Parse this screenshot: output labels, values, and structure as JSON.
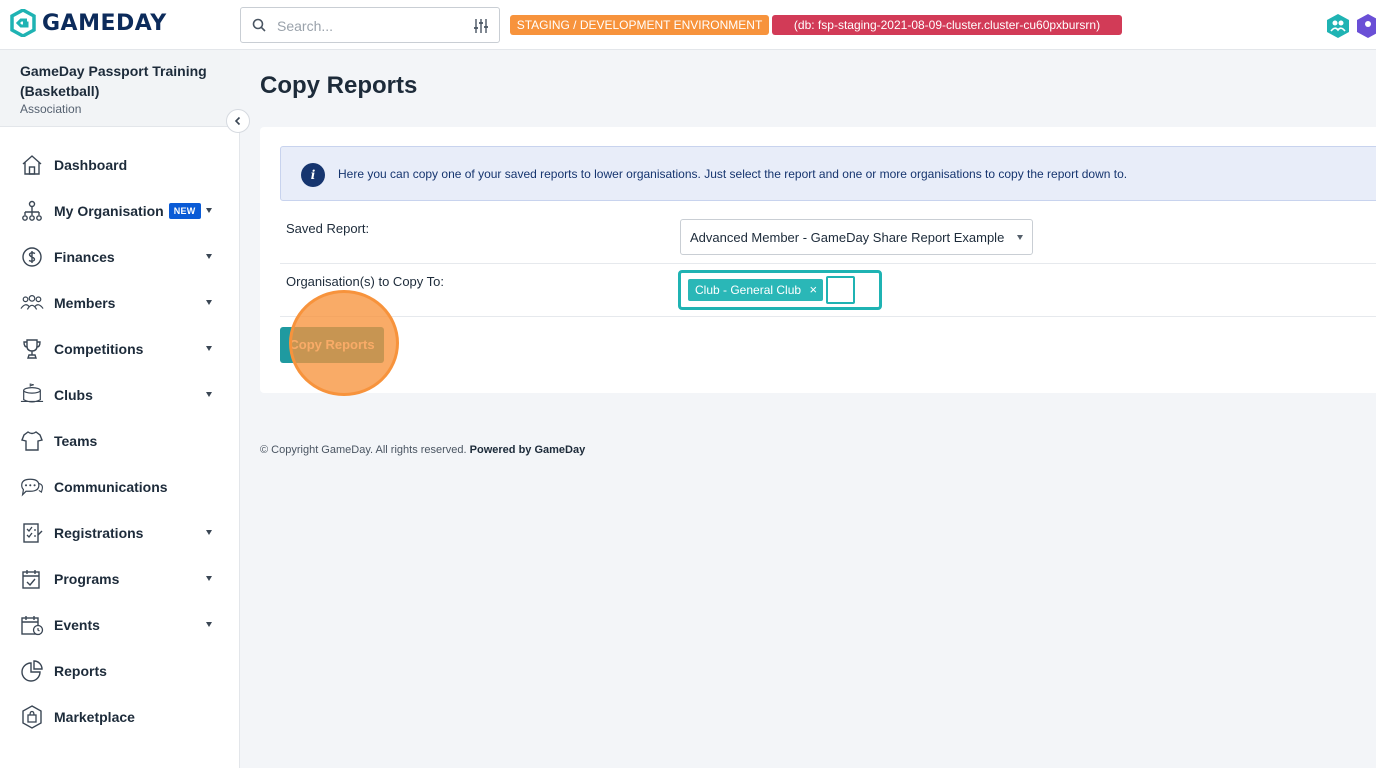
{
  "app": {
    "logo_text": "GAMEDAY",
    "brand_color": "#1fb3b3",
    "logo_color": "#0c2b5b"
  },
  "search": {
    "placeholder": "Search...",
    "icon": "search-icon",
    "filter_icon": "sliders-icon"
  },
  "environment": {
    "staging_label": "STAGING / DEVELOPMENT ENVIRONMENT",
    "staging_color": "#f7933c",
    "db_label": "(db: fsp-staging-2021-08-09-cluster.cluster-cu60pxbursrn)",
    "db_color": "#d23b57"
  },
  "sidebar": {
    "org_name": "GameDay Passport Training (Basketball)",
    "org_type": "Association",
    "items": [
      {
        "label": "Dashboard",
        "icon": "home-icon",
        "has_caret": false
      },
      {
        "label": "My Organisation",
        "icon": "org-chart-icon",
        "has_caret": true,
        "badge": "NEW"
      },
      {
        "label": "Finances",
        "icon": "dollar-icon",
        "has_caret": true
      },
      {
        "label": "Members",
        "icon": "members-icon",
        "has_caret": true
      },
      {
        "label": "Competitions",
        "icon": "trophy-icon",
        "has_caret": true
      },
      {
        "label": "Clubs",
        "icon": "stadium-icon",
        "has_caret": true
      },
      {
        "label": "Teams",
        "icon": "jersey-icon",
        "has_caret": false
      },
      {
        "label": "Communications",
        "icon": "chat-icon",
        "has_caret": false
      },
      {
        "label": "Registrations",
        "icon": "clipboard-icon",
        "has_caret": true
      },
      {
        "label": "Programs",
        "icon": "calendar-check-icon",
        "has_caret": true
      },
      {
        "label": "Events",
        "icon": "calendar-icon",
        "has_caret": true
      },
      {
        "label": "Reports",
        "icon": "pie-chart-icon",
        "has_caret": false
      },
      {
        "label": "Marketplace",
        "icon": "shopping-bag-icon",
        "has_caret": false
      }
    ]
  },
  "main": {
    "title": "Copy Reports",
    "info_text": "Here you can copy one of your saved reports to lower organisations. Just select the report and one or more organisations to copy the report down to.",
    "saved_report_label": "Saved Report:",
    "saved_report_value": "Advanced Member - GameDay Share Report Example",
    "orgs_label": "Organisation(s) to Copy To:",
    "selected_orgs": [
      "Club - General Club"
    ],
    "tag_remove": "×",
    "copy_button": "Copy Reports"
  },
  "footer": {
    "copyright_symbol": "©",
    "copyright": "Copyright GameDay. All rights reserved.",
    "powered_by": "Powered by GameDay"
  }
}
